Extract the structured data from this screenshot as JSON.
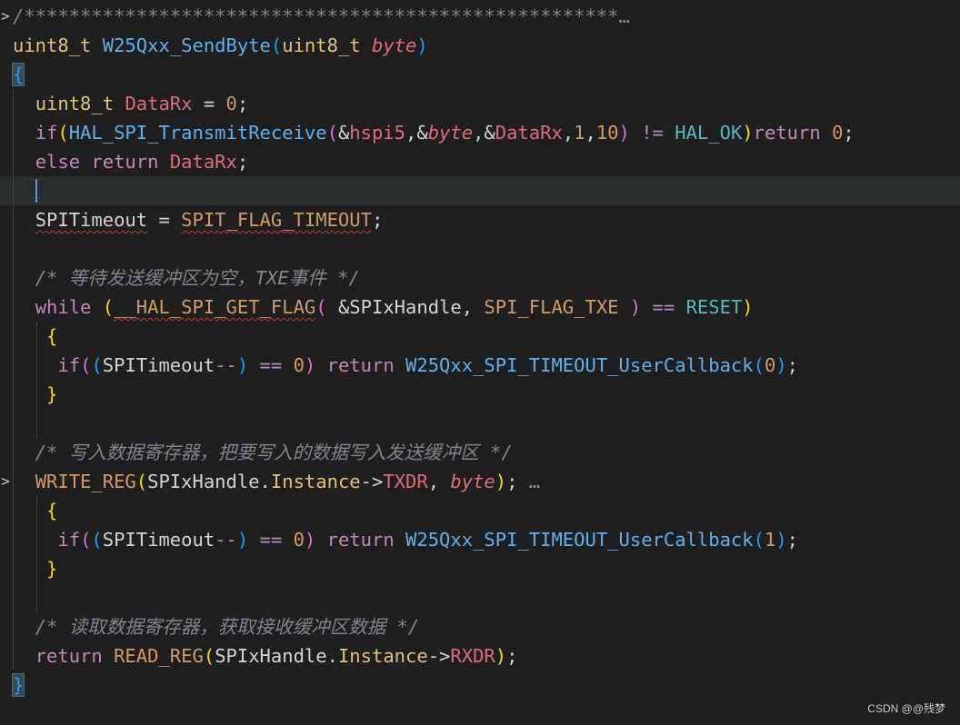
{
  "colors": {
    "background": "#1f1f1f",
    "keyword": "#c586c0",
    "type": "#e5c07b",
    "function": "#61afef",
    "variable": "#e06c75",
    "constant": "#d19a66",
    "comment": "#7f848e",
    "punct": "#abb2bf",
    "bracket1": "#ffd700",
    "bracket2": "#da70d6",
    "bracket3": "#179fff",
    "plain": "#d4d4d4",
    "teal": "#56b6c2"
  },
  "fold_glyph": ">",
  "ellipsis": "…",
  "watermark": "CSDN @@残梦",
  "lines": [
    {
      "fold": true,
      "tokens": [
        [
          "comment",
          "/*****************************************************"
        ],
        [
          "ellipsis",
          "…"
        ]
      ]
    },
    {
      "tokens": [
        [
          "type",
          "uint8_t"
        ],
        [
          "plain",
          " "
        ],
        [
          "function",
          "W25Qxx_SendByte"
        ],
        [
          "bracket3",
          "("
        ],
        [
          "type",
          "uint8_t"
        ],
        [
          "plain",
          " "
        ],
        [
          "variable-italic",
          "byte"
        ],
        [
          "bracket3",
          ")"
        ]
      ]
    },
    {
      "tokens": [
        [
          "brace-hl",
          "{"
        ]
      ]
    },
    {
      "tokens": [
        [
          "plain",
          "  "
        ],
        [
          "type",
          "uint8_t"
        ],
        [
          "plain",
          " "
        ],
        [
          "variable",
          "DataRx"
        ],
        [
          "plain",
          " = "
        ],
        [
          "constant",
          "0"
        ],
        [
          "plain",
          ";"
        ]
      ]
    },
    {
      "tokens": [
        [
          "plain",
          "  "
        ],
        [
          "keyword",
          "if"
        ],
        [
          "bracket1",
          "("
        ],
        [
          "function",
          "HAL_SPI_TransmitReceive"
        ],
        [
          "bracket2",
          "("
        ],
        [
          "plain",
          "&"
        ],
        [
          "variable",
          "hspi5"
        ],
        [
          "plain",
          ",&"
        ],
        [
          "variable-italic",
          "byte"
        ],
        [
          "plain",
          ",&"
        ],
        [
          "variable",
          "DataRx"
        ],
        [
          "plain",
          ","
        ],
        [
          "constant",
          "1"
        ],
        [
          "plain",
          ","
        ],
        [
          "constant",
          "10"
        ],
        [
          "bracket2",
          ")"
        ],
        [
          "plain",
          " "
        ],
        [
          "keyword",
          "!="
        ],
        [
          "plain",
          " "
        ],
        [
          "teal",
          "HAL_OK"
        ],
        [
          "bracket1",
          ")"
        ],
        [
          "keyword",
          "return"
        ],
        [
          "plain",
          " "
        ],
        [
          "constant",
          "0"
        ],
        [
          "plain",
          ";"
        ]
      ]
    },
    {
      "tokens": [
        [
          "plain",
          "  "
        ],
        [
          "keyword",
          "else"
        ],
        [
          "plain",
          " "
        ],
        [
          "keyword",
          "return"
        ],
        [
          "plain",
          " "
        ],
        [
          "variable",
          "DataRx"
        ],
        [
          "plain",
          ";"
        ]
      ]
    },
    {
      "current": true,
      "tokens": []
    },
    {
      "tokens": [
        [
          "plain",
          "  "
        ],
        [
          "plain-squig",
          "SPITimeout"
        ],
        [
          "plain",
          " = "
        ],
        [
          "constant-squig",
          "SPIT_FLAG_TIMEOUT"
        ],
        [
          "plain",
          ";"
        ]
      ]
    },
    {
      "tokens": []
    },
    {
      "tokens": [
        [
          "plain",
          "  "
        ],
        [
          "comment",
          "/* 等待发送缓冲区为空，TXE事件 */"
        ]
      ]
    },
    {
      "tokens": [
        [
          "plain",
          "  "
        ],
        [
          "keyword",
          "while"
        ],
        [
          "plain",
          " "
        ],
        [
          "bracket1",
          "("
        ],
        [
          "constant-squig",
          "__HAL_SPI_GET_FLAG"
        ],
        [
          "bracket2",
          "("
        ],
        [
          "plain",
          " &"
        ],
        [
          "plain",
          "SPIxHandle"
        ],
        [
          "plain",
          ", "
        ],
        [
          "constant",
          "SPI_FLAG_TXE"
        ],
        [
          "plain",
          " "
        ],
        [
          "bracket2",
          ")"
        ],
        [
          "plain",
          " "
        ],
        [
          "keyword",
          "=="
        ],
        [
          "plain",
          " "
        ],
        [
          "teal",
          "RESET"
        ],
        [
          "bracket1",
          ")"
        ]
      ]
    },
    {
      "tokens": [
        [
          "plain",
          "   "
        ],
        [
          "bracket1",
          "{"
        ]
      ]
    },
    {
      "tokens": [
        [
          "plain",
          "    "
        ],
        [
          "keyword",
          "if"
        ],
        [
          "bracket2",
          "("
        ],
        [
          "bracket3",
          "("
        ],
        [
          "plain",
          "SPITimeout"
        ],
        [
          "keyword",
          "--"
        ],
        [
          "bracket3",
          ")"
        ],
        [
          "plain",
          " "
        ],
        [
          "keyword",
          "=="
        ],
        [
          "plain",
          " "
        ],
        [
          "constant",
          "0"
        ],
        [
          "bracket2",
          ")"
        ],
        [
          "plain",
          " "
        ],
        [
          "keyword",
          "return"
        ],
        [
          "plain",
          " "
        ],
        [
          "function",
          "W25Qxx_SPI_TIMEOUT_UserCallback"
        ],
        [
          "bracket3",
          "("
        ],
        [
          "constant",
          "0"
        ],
        [
          "bracket3",
          ")"
        ],
        [
          "plain",
          ";"
        ]
      ]
    },
    {
      "tokens": [
        [
          "plain",
          "   "
        ],
        [
          "bracket1",
          "}"
        ]
      ]
    },
    {
      "tokens": []
    },
    {
      "tokens": [
        [
          "plain",
          "  "
        ],
        [
          "comment",
          "/* 写入数据寄存器，把要写入的数据写入发送缓冲区 */"
        ]
      ]
    },
    {
      "fold": true,
      "tokens": [
        [
          "plain",
          "  "
        ],
        [
          "constant",
          "WRITE_REG"
        ],
        [
          "bracket1",
          "("
        ],
        [
          "plain",
          "SPIxHandle"
        ],
        [
          "plain",
          "."
        ],
        [
          "type",
          "Instance"
        ],
        [
          "plain",
          "->"
        ],
        [
          "variable",
          "TXDR"
        ],
        [
          "plain",
          ", "
        ],
        [
          "variable-italic",
          "byte"
        ],
        [
          "bracket1",
          ")"
        ],
        [
          "plain",
          ";"
        ],
        [
          "ellipsis",
          " …"
        ]
      ]
    },
    {
      "tokens": [
        [
          "plain",
          "   "
        ],
        [
          "bracket1",
          "{"
        ]
      ]
    },
    {
      "tokens": [
        [
          "plain",
          "    "
        ],
        [
          "keyword",
          "if"
        ],
        [
          "bracket2",
          "("
        ],
        [
          "bracket3",
          "("
        ],
        [
          "plain",
          "SPITimeout"
        ],
        [
          "keyword",
          "--"
        ],
        [
          "bracket3",
          ")"
        ],
        [
          "plain",
          " "
        ],
        [
          "keyword",
          "=="
        ],
        [
          "plain",
          " "
        ],
        [
          "constant",
          "0"
        ],
        [
          "bracket2",
          ")"
        ],
        [
          "plain",
          " "
        ],
        [
          "keyword",
          "return"
        ],
        [
          "plain",
          " "
        ],
        [
          "function",
          "W25Qxx_SPI_TIMEOUT_UserCallback"
        ],
        [
          "bracket3",
          "("
        ],
        [
          "constant",
          "1"
        ],
        [
          "bracket3",
          ")"
        ],
        [
          "plain",
          ";"
        ]
      ]
    },
    {
      "tokens": [
        [
          "plain",
          "   "
        ],
        [
          "bracket1",
          "}"
        ]
      ]
    },
    {
      "tokens": []
    },
    {
      "tokens": [
        [
          "plain",
          "  "
        ],
        [
          "comment",
          "/* 读取数据寄存器，获取接收缓冲区数据 */"
        ]
      ]
    },
    {
      "tokens": [
        [
          "plain",
          "  "
        ],
        [
          "keyword",
          "return"
        ],
        [
          "plain",
          " "
        ],
        [
          "constant",
          "READ_REG"
        ],
        [
          "bracket1",
          "("
        ],
        [
          "plain",
          "SPIxHandle"
        ],
        [
          "plain",
          "."
        ],
        [
          "type",
          "Instance"
        ],
        [
          "plain",
          "->"
        ],
        [
          "variable",
          "RXDR"
        ],
        [
          "bracket1",
          ")"
        ],
        [
          "plain",
          ";"
        ]
      ]
    },
    {
      "tokens": [
        [
          "brace-hl",
          "}"
        ]
      ]
    }
  ]
}
